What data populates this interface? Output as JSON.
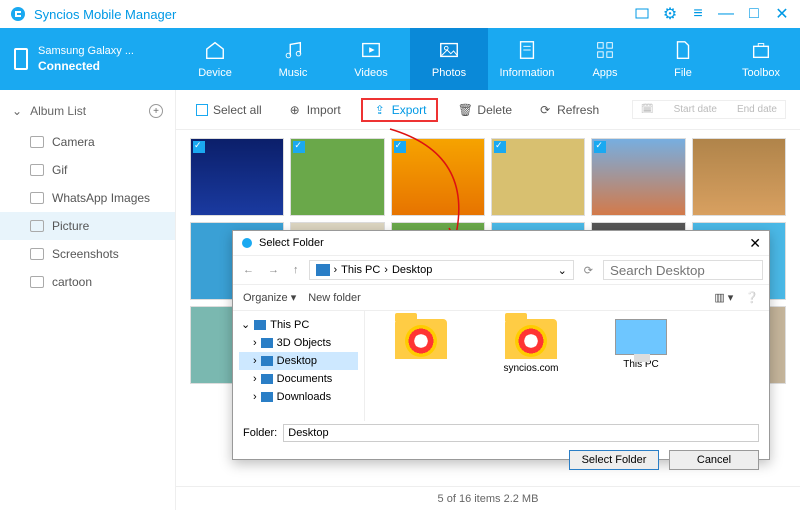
{
  "app": {
    "title": "Syncios Mobile Manager"
  },
  "device": {
    "name": "Samsung Galaxy ...",
    "status": "Connected"
  },
  "nav": {
    "device": "Device",
    "music": "Music",
    "videos": "Videos",
    "photos": "Photos",
    "information": "Information",
    "apps": "Apps",
    "file": "File",
    "toolbox": "Toolbox"
  },
  "sidebar": {
    "heading": "Album List",
    "items": [
      "Camera",
      "Gif",
      "WhatsApp Images",
      "Picture",
      "Screenshots",
      "cartoon"
    ]
  },
  "toolbar": {
    "select_all": "Select all",
    "import": "Import",
    "export": "Export",
    "delete": "Delete",
    "refresh": "Refresh",
    "start_date": "Start date",
    "end_date": "End date"
  },
  "status": "5 of 16 items 2.2 MB",
  "dialog": {
    "title": "Select Folder",
    "crumb1": "This PC",
    "crumb2": "Desktop",
    "search_placeholder": "Search Desktop",
    "organize": "Organize",
    "new_folder": "New folder",
    "tree": [
      "This PC",
      "3D Objects",
      "Desktop",
      "Documents",
      "Downloads"
    ],
    "files": {
      "item1": "syncios.com",
      "item2": "This PC",
      "item0": " "
    },
    "folder_label": "Folder:",
    "folder_value": "Desktop",
    "select_btn": "Select Folder",
    "cancel_btn": "Cancel"
  }
}
